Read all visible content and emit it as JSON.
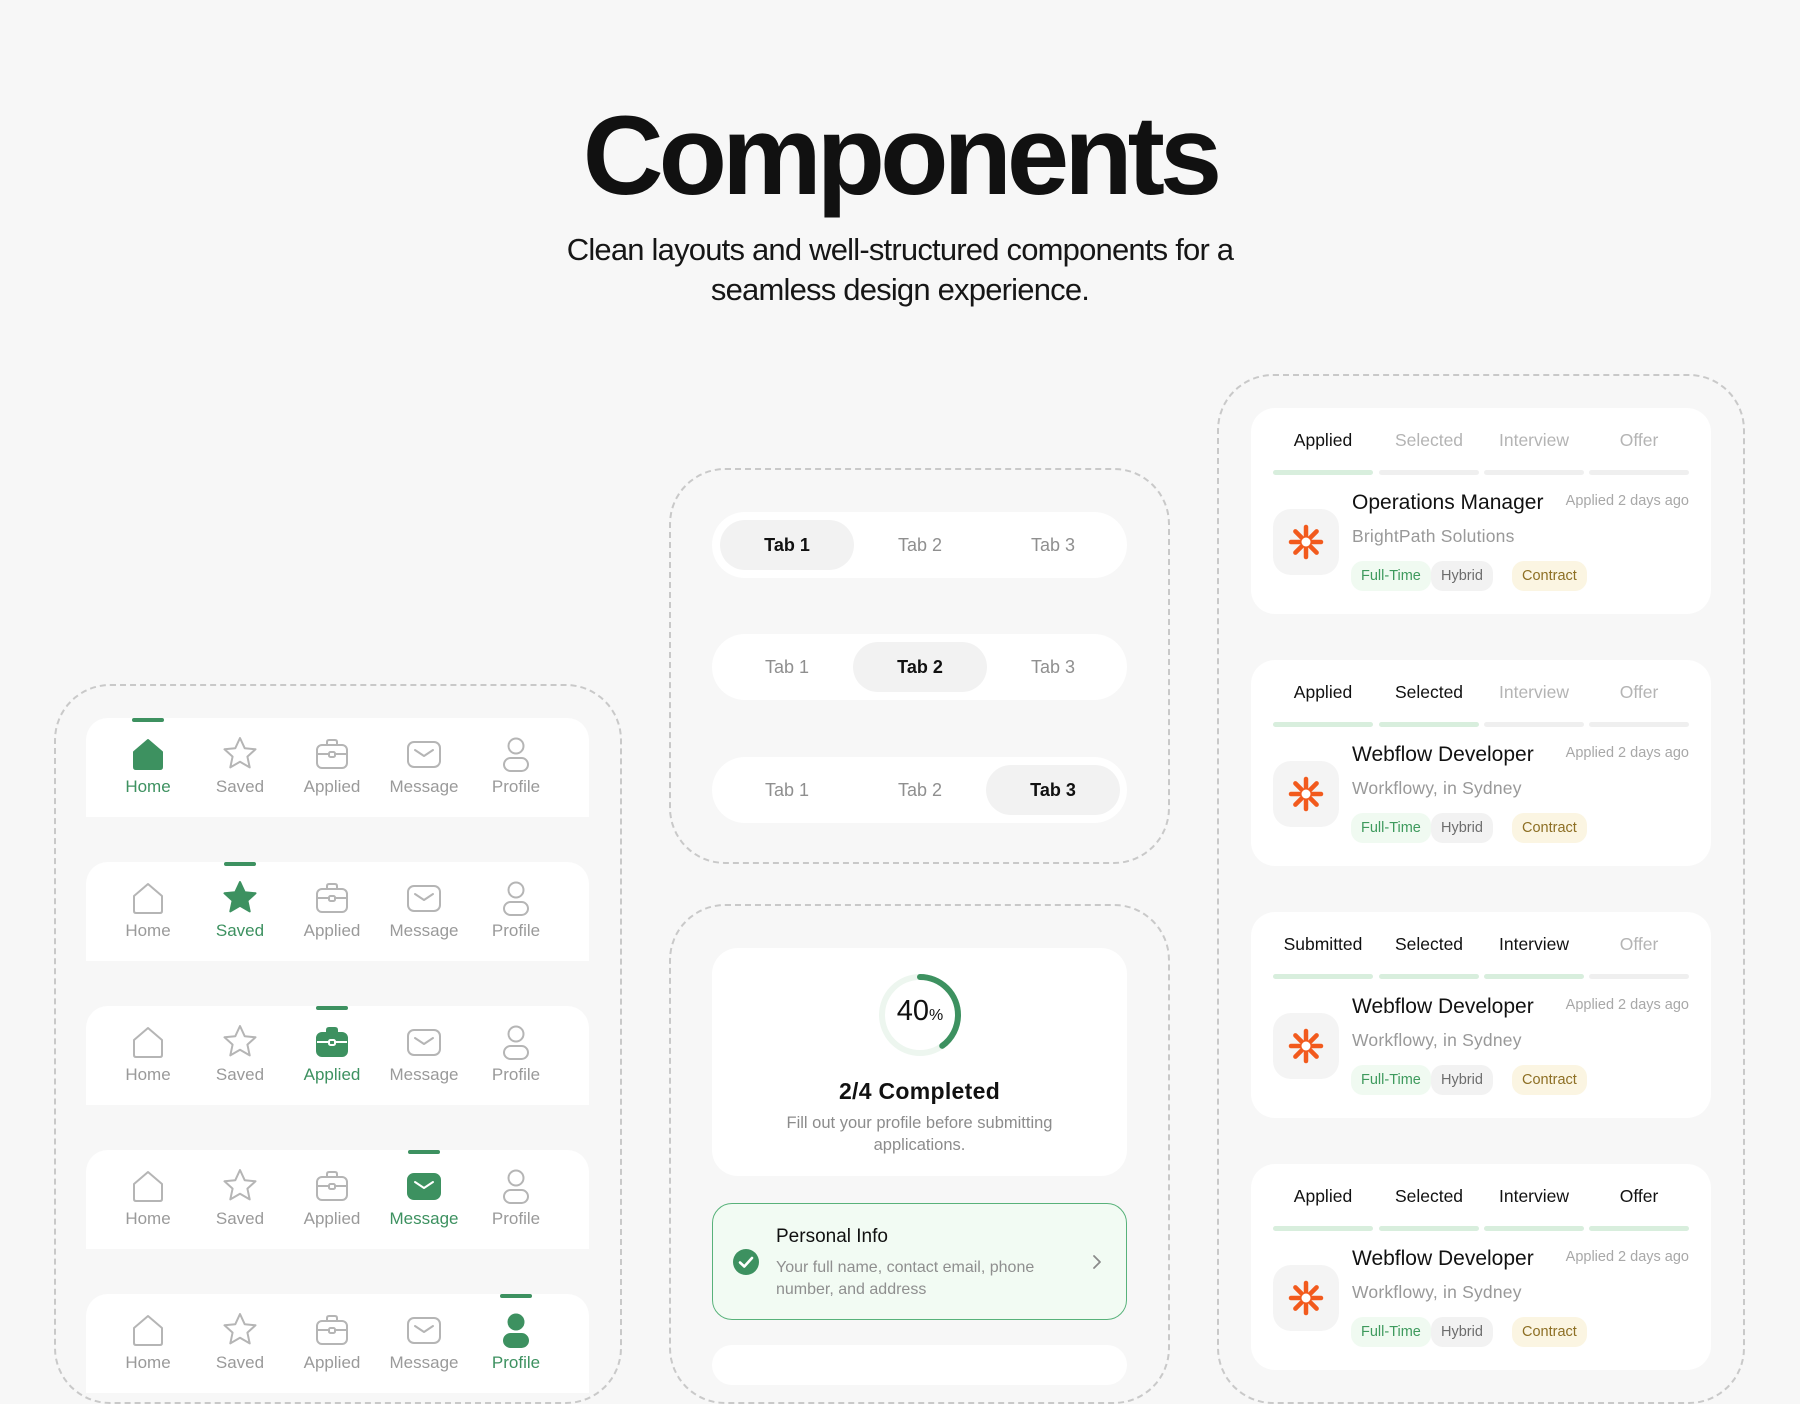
{
  "hero": {
    "title": "Components",
    "subtitle": "Clean layouts and well-structured components for a seamless design experience."
  },
  "bottom_nav": {
    "labels": [
      "Home",
      "Saved",
      "Applied",
      "Message",
      "Profile"
    ],
    "active_color": "#3d9160",
    "inactive_color": "#9a9a9a",
    "bars": [
      {
        "active": "Home"
      },
      {
        "active": "Saved"
      },
      {
        "active": "Applied"
      },
      {
        "active": "Message"
      },
      {
        "active": "Profile"
      }
    ]
  },
  "tabs": {
    "labels": [
      "Tab 1",
      "Tab 2",
      "Tab 3"
    ],
    "variants": [
      {
        "active": "Tab 1"
      },
      {
        "active": "Tab 2"
      },
      {
        "active": "Tab 3"
      }
    ]
  },
  "progress": {
    "percent": "40",
    "percent_sign": "%",
    "percent_value": 0.4,
    "title": "2/4 Completed",
    "description": "Fill out your profile before submitting applications."
  },
  "step": {
    "title": "Personal Info",
    "description": "Your full name, contact email, phone number, and address",
    "status": "complete"
  },
  "job_cards": [
    {
      "stages": [
        {
          "label": "Applied",
          "done": true
        },
        {
          "label": "Selected",
          "done": false
        },
        {
          "label": "Interview",
          "done": false
        },
        {
          "label": "Offer",
          "done": false
        }
      ],
      "title": "Operations Manager",
      "company": "BrightPath Solutions",
      "time": "Applied 2 days ago",
      "tags": [
        "Full-Time",
        "Hybrid",
        "Contract"
      ]
    },
    {
      "stages": [
        {
          "label": "Applied",
          "done": true
        },
        {
          "label": "Selected",
          "done": true
        },
        {
          "label": "Interview",
          "done": false
        },
        {
          "label": "Offer",
          "done": false
        }
      ],
      "title": "Webflow Developer",
      "company": "Workflowy, in Sydney",
      "time": "Applied 2 days ago",
      "tags": [
        "Full-Time",
        "Hybrid",
        "Contract"
      ]
    },
    {
      "stages": [
        {
          "label": "Submitted",
          "done": true
        },
        {
          "label": "Selected",
          "done": true
        },
        {
          "label": "Interview",
          "done": true
        },
        {
          "label": "Offer",
          "done": false
        }
      ],
      "title": "Webflow Developer",
      "company": "Workflowy, in Sydney",
      "time": "Applied 2 days ago",
      "tags": [
        "Full-Time",
        "Hybrid",
        "Contract"
      ]
    },
    {
      "stages": [
        {
          "label": "Applied",
          "done": true
        },
        {
          "label": "Selected",
          "done": true
        },
        {
          "label": "Interview",
          "done": true
        },
        {
          "label": "Offer",
          "done": true
        }
      ],
      "title": "Webflow Developer",
      "company": "Workflowy, in Sydney",
      "time": "Applied 2 days ago",
      "tags": [
        "Full-Time",
        "Hybrid",
        "Contract"
      ]
    }
  ],
  "colors": {
    "accent_green": "#3d9160",
    "logo_orange": "#f25a1d",
    "background": "#f7f7f7"
  }
}
